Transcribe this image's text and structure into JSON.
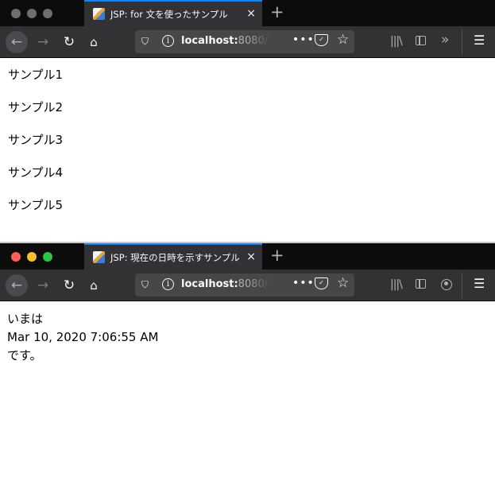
{
  "window1": {
    "tab_title": "JSP: for 文を使ったサンプル",
    "tab_close": "×",
    "url_host": "localhost:",
    "url_port": "8080/",
    "page_lines": [
      "サンプル1",
      "サンプル2",
      "サンプル3",
      "サンプル4",
      "サンプル5"
    ]
  },
  "window2": {
    "tab_title": "JSP: 現在の日時を示すサンプル",
    "tab_close": "×",
    "url_host": "localhost:",
    "url_port": "8080/",
    "page_lines": [
      "いまは",
      "Mar 10, 2020 7:06:55 AM",
      "です。"
    ]
  },
  "toolbar": {
    "new_tab": "+",
    "back": "←",
    "forward": "→",
    "reload": "↻",
    "home": "⌂",
    "more": "•••",
    "star": "☆",
    "library": "|||\\",
    "overflow": "»",
    "menu": "☰",
    "info": "i",
    "shield": "⛉"
  },
  "colors": {
    "tabbar_bg": "#0c0c0d",
    "toolbar_bg": "#323234",
    "accent": "#0a84ff",
    "traffic_red": "#ff5f57",
    "traffic_yellow": "#febc2e",
    "traffic_green": "#28c840",
    "inactive_light": "#6e6e70"
  }
}
